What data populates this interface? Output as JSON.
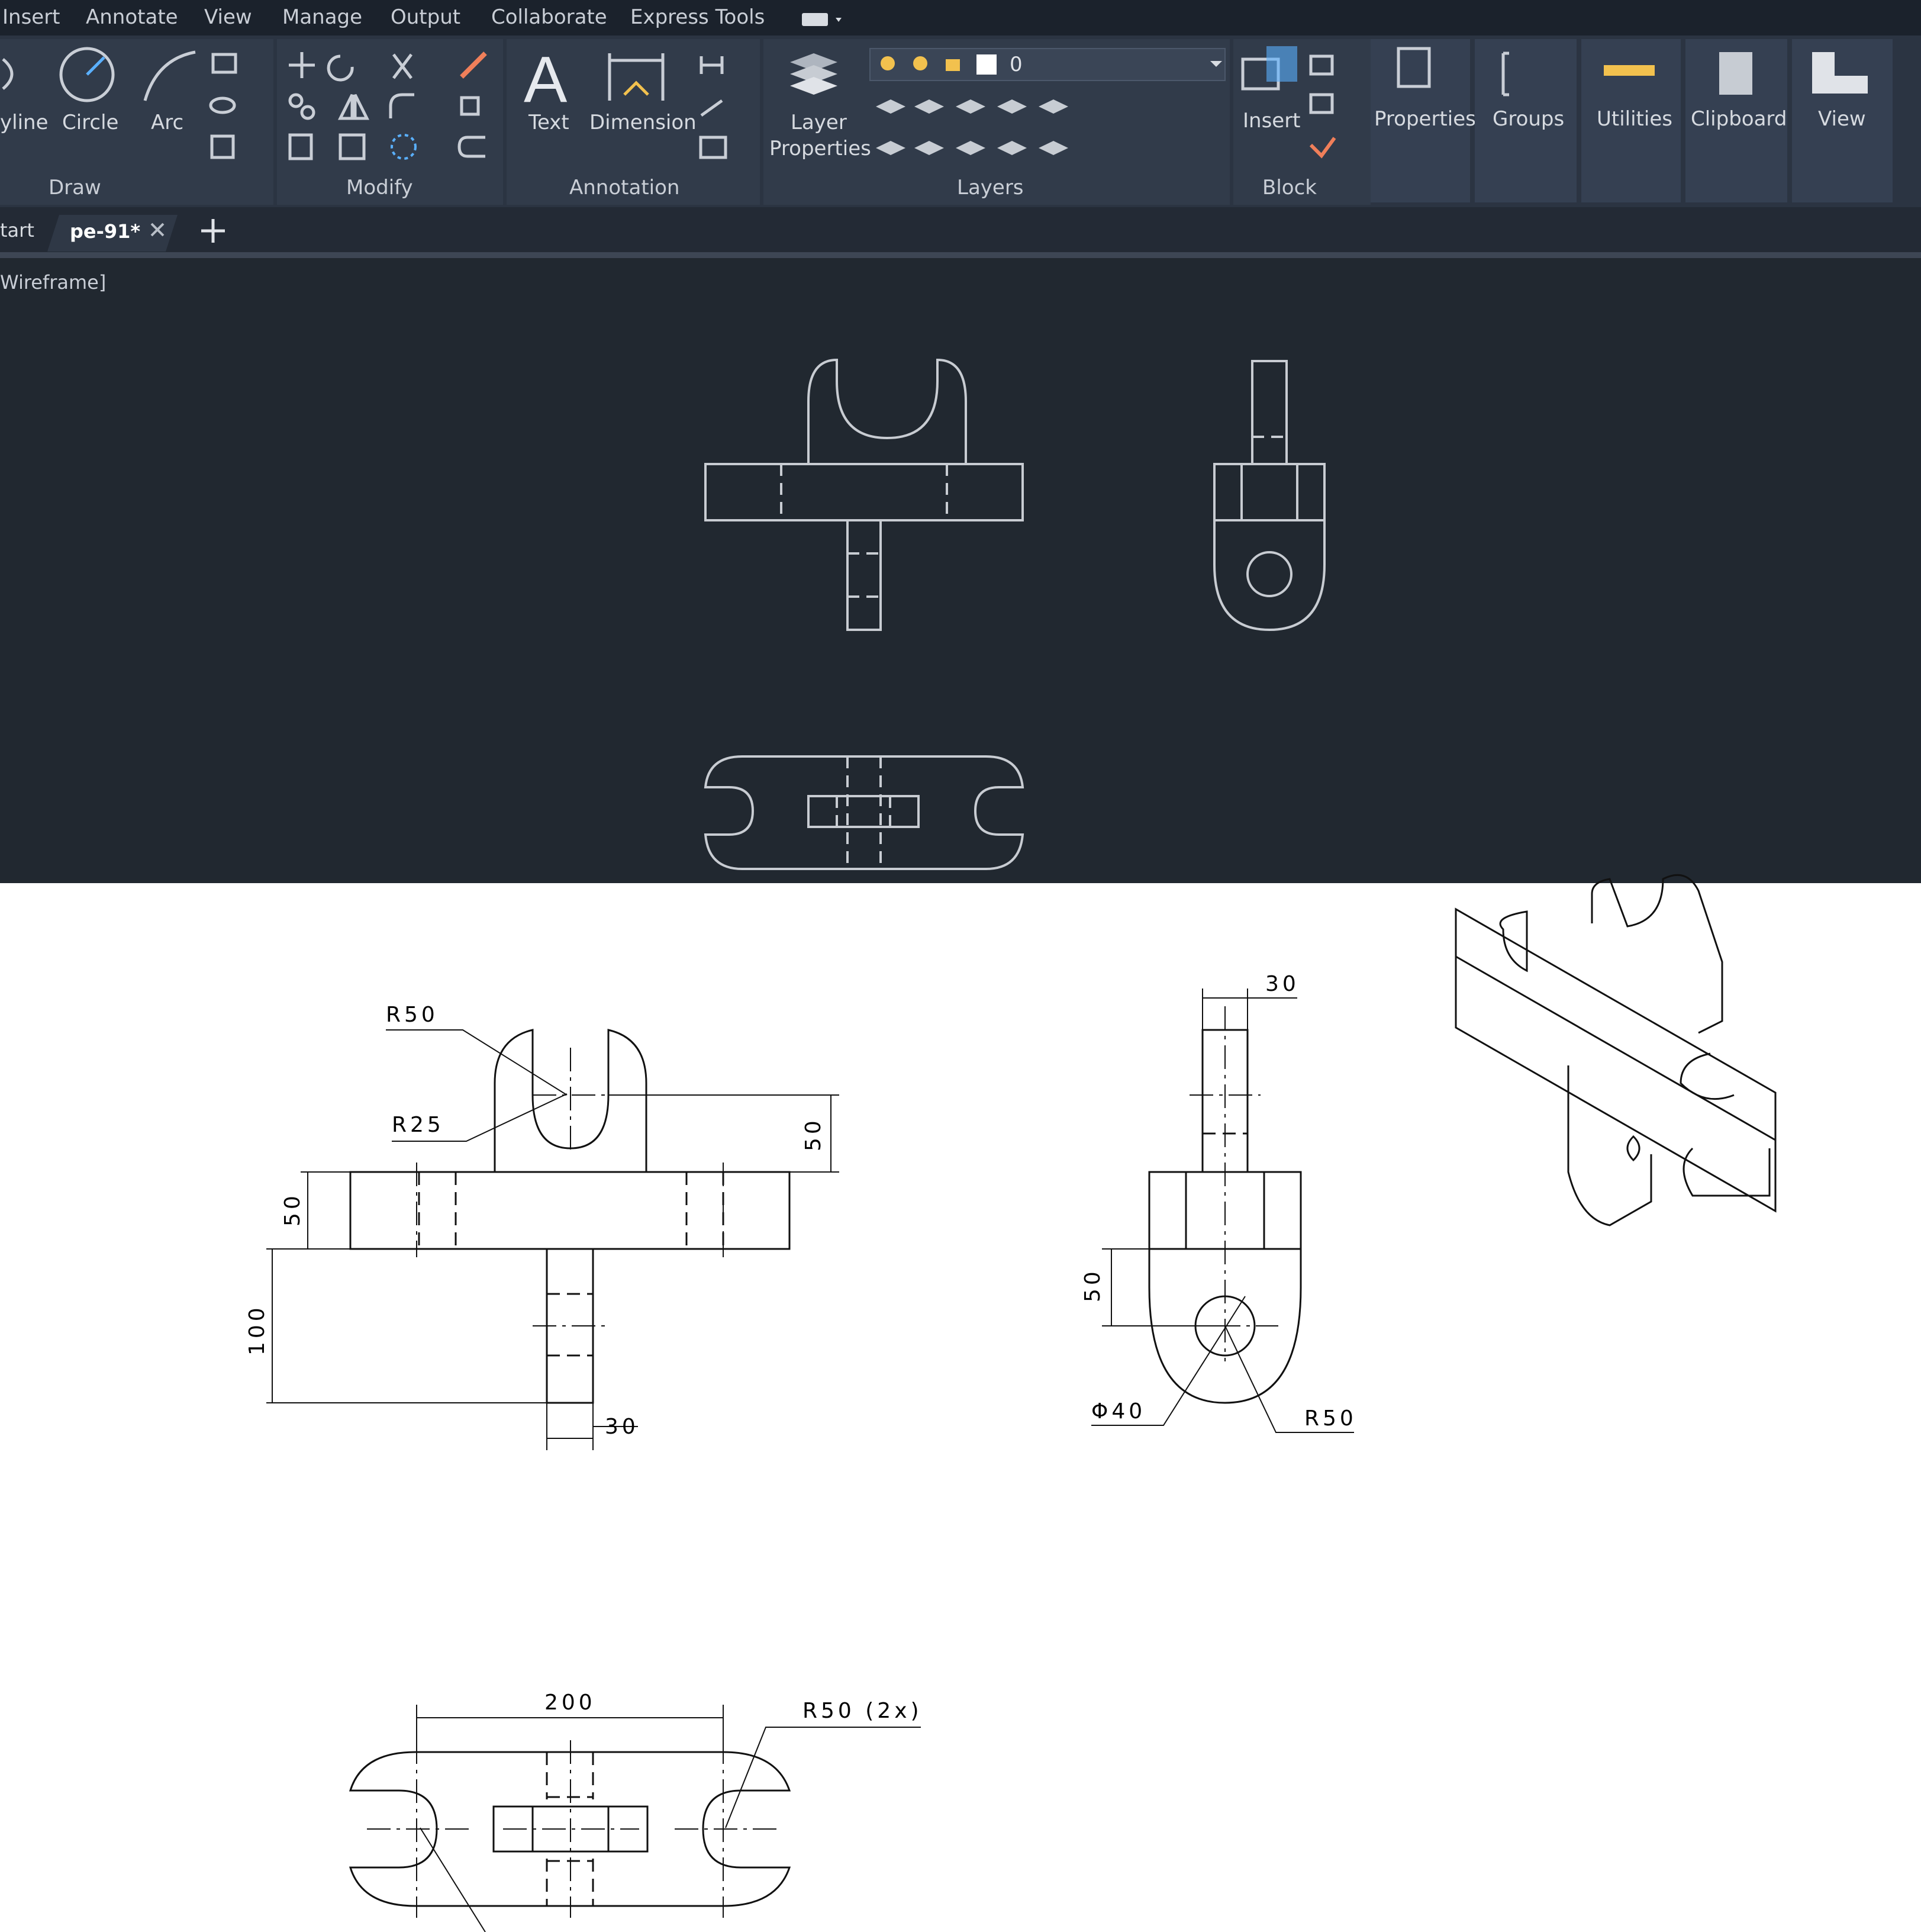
{
  "menu": {
    "items": [
      "Insert",
      "Annotate",
      "View",
      "Manage",
      "Output",
      "Collaborate",
      "Express Tools"
    ]
  },
  "ribbon": {
    "draw": {
      "polyline_label": "yline",
      "circle_label": "Circle",
      "arc_label": "Arc",
      "title": "Draw"
    },
    "modify": {
      "title": "Modify"
    },
    "annotation": {
      "text_label": "Text",
      "dimension_label": "Dimension",
      "title": "Annotation"
    },
    "layers": {
      "layer_properties_line1": "Layer",
      "layer_properties_line2": "Properties",
      "current_layer": "0",
      "title": "Layers"
    },
    "block": {
      "insert_label": "Insert",
      "title": "Block"
    },
    "properties_label": "Properties",
    "groups_label": "Groups",
    "utilities_label": "Utilities",
    "clipboard_label": "Clipboard",
    "view_label": "View"
  },
  "tabs": {
    "start": "tart",
    "active": "pe-91*"
  },
  "viewport": {
    "label": "Wireframe]"
  },
  "reference": {
    "front": {
      "r50": "R50",
      "r25": "R25",
      "d50_right": "50",
      "d50_left": "50",
      "d100": "100",
      "d30": "30"
    },
    "side": {
      "d30": "30",
      "d50": "50",
      "phi40": "Φ40",
      "r50": "R50"
    },
    "top": {
      "d200": "200",
      "r50_2x": "R50 (2x)"
    }
  },
  "colors": {
    "menubar": "#1b222c",
    "ribbon": "#2b3442",
    "tabbar": "#232a35",
    "viewport": "#212830",
    "accent_yellow": "#f2c14e",
    "accent_blue": "#5ab0ff"
  }
}
